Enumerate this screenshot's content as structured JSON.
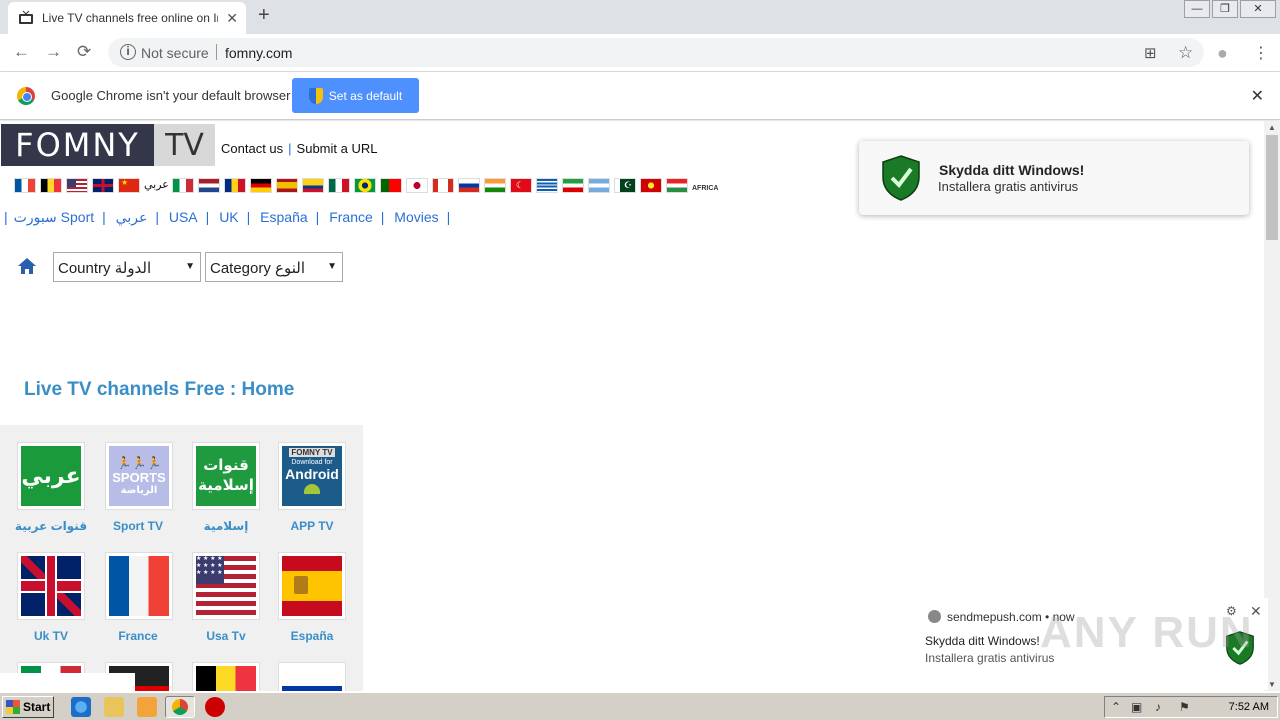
{
  "browser": {
    "tab_title": "Live TV channels free online on Internet",
    "tab_close": "✕",
    "new_tab": "+",
    "win_min": "—",
    "win_max": "❐",
    "win_close": "✕",
    "nav_back": "←",
    "nav_forward": "→",
    "nav_reload": "⟳",
    "not_secure": "Not secure",
    "url": "fomny.com",
    "translate_icon": "⊞",
    "star_icon": "☆",
    "profile_icon": "●",
    "menu_icon": "⋮"
  },
  "infobar": {
    "message": "Google Chrome isn't your default browser",
    "button": "Set as default",
    "close": "✕"
  },
  "site": {
    "logo_part1": "FOMNY",
    "logo_part2": "TV",
    "contact": "Contact us",
    "submit": "Submit a URL",
    "flag_arabic": "عربي",
    "flag_africa": "AFRICA",
    "cat_links": [
      "سبورت Sport",
      "عربي",
      "USA",
      "UK",
      "España",
      "France",
      "Movies"
    ],
    "select_country": "Country الدولة",
    "select_category": "Category النوع",
    "heading": "Live TV channels Free : Home",
    "tiles": [
      {
        "label": "قنوات عربية",
        "img_text": "عربي"
      },
      {
        "label": "Sport TV",
        "img_text": "SPORTS"
      },
      {
        "label": "إسلامية",
        "img_text": "قنوات إسلامية"
      },
      {
        "label": "APP TV",
        "img_text": "Android"
      },
      {
        "label": "Uk TV",
        "img_text": ""
      },
      {
        "label": "France",
        "img_text": ""
      },
      {
        "label": "Usa Tv",
        "img_text": ""
      },
      {
        "label": "España",
        "img_text": ""
      }
    ],
    "tile_img_sports_sub": "الرياضة",
    "tile_img_android_top": "FOMNY TV",
    "tile_img_android_mid": "Download for"
  },
  "popup": {
    "title": "Skydda ditt Windows!",
    "subtitle": "Installera gratis antivirus"
  },
  "push": {
    "source": "sendmepush.com • now",
    "title": "Skydda ditt Windows!",
    "subtitle": "Installera gratis antivirus",
    "gear": "⚙",
    "close": "✕"
  },
  "watermark": "ANY RUN",
  "taskbar": {
    "start": "Start",
    "clock": "7:52 AM"
  },
  "colors": {
    "link_blue": "#2a6fd6",
    "heading_blue": "#3a8ec8",
    "chrome_button": "#4d90fe"
  }
}
